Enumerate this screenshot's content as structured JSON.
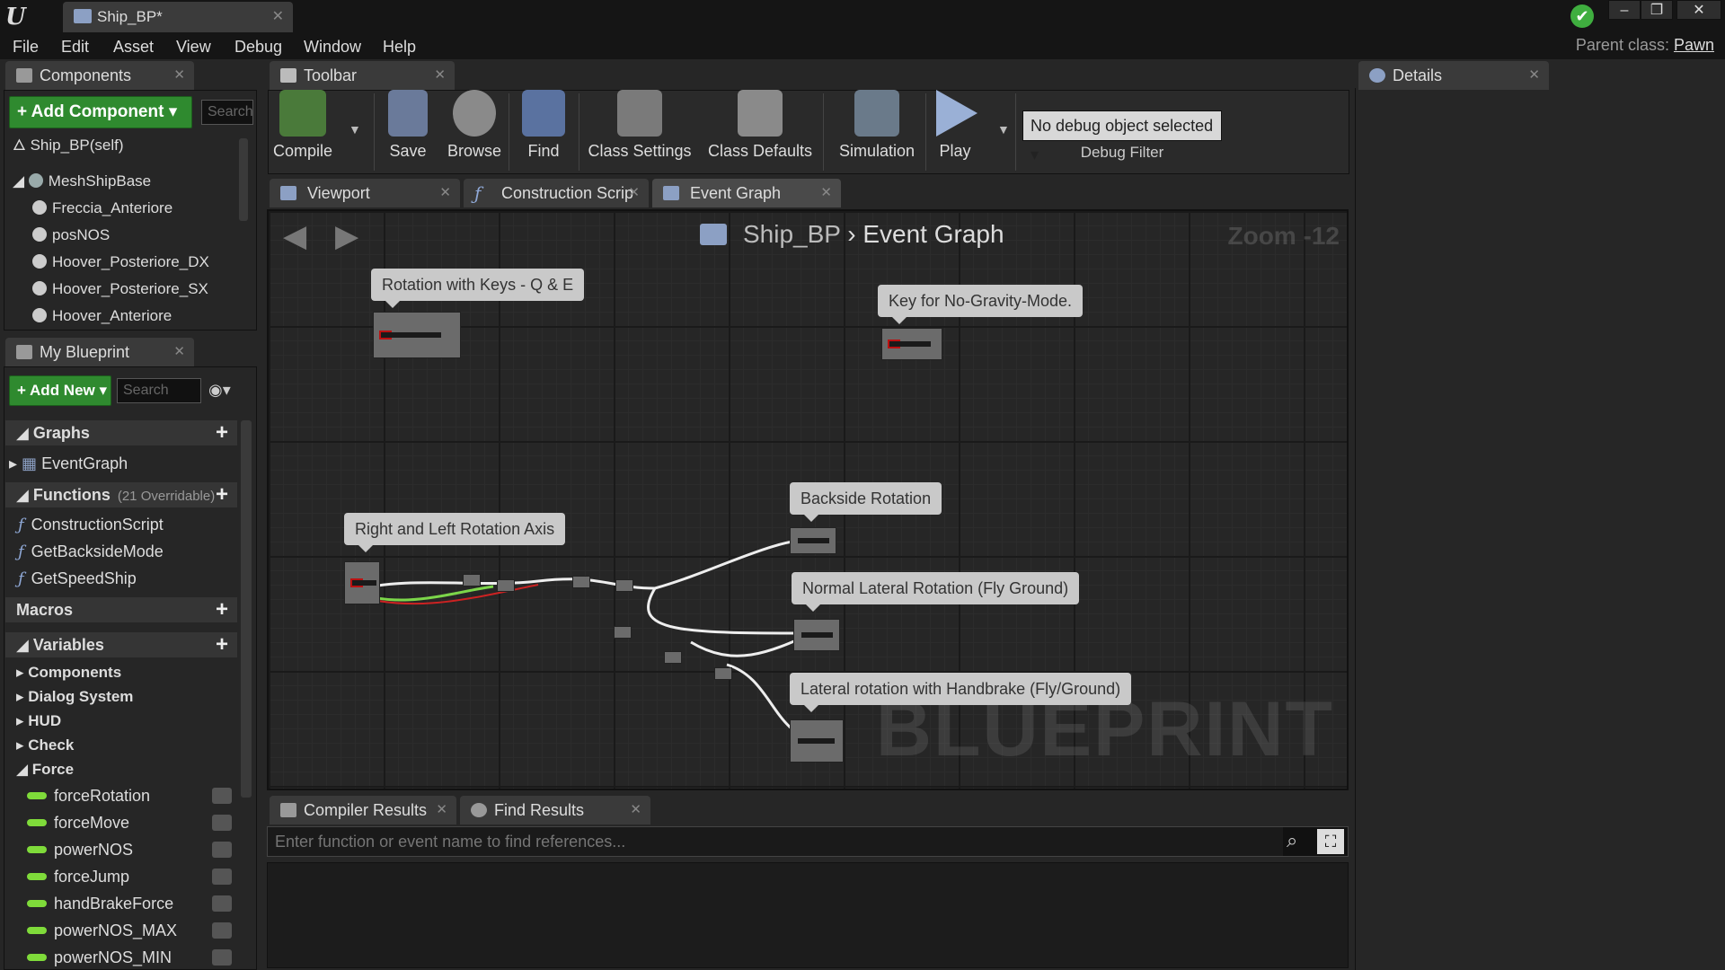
{
  "window": {
    "tab_title": "Ship_BP*",
    "parent_label": "Parent class:",
    "parent_value": "Pawn"
  },
  "menu": [
    "File",
    "Edit",
    "Asset",
    "View",
    "Debug",
    "Window",
    "Help"
  ],
  "components": {
    "tab": "Components",
    "add_label": "Add Component",
    "search_placeholder": "Search",
    "self": "Ship_BP(self)",
    "tree": [
      "MeshShipBase",
      "Freccia_Anteriore",
      "posNOS",
      "Hoover_Posteriore_DX",
      "Hoover_Posteriore_SX",
      "Hoover_Anteriore"
    ]
  },
  "my_blueprint": {
    "tab": "My Blueprint",
    "add_label": "Add New",
    "search_placeholder": "Search",
    "graphs_label": "Graphs",
    "graphs": [
      "EventGraph"
    ],
    "functions_label": "Functions",
    "functions_count": "(21 Overridable)",
    "functions": [
      "ConstructionScript",
      "GetBacksideMode",
      "GetSpeedShip"
    ],
    "macros_label": "Macros",
    "variables_label": "Variables",
    "categories": [
      "Components",
      "Dialog System",
      "HUD",
      "Check",
      "Force"
    ],
    "variables": [
      "forceRotation",
      "forceMove",
      "powerNOS",
      "forceJump",
      "handBrakeForce",
      "powerNOS_MAX",
      "powerNOS_MIN"
    ]
  },
  "toolbar": {
    "tab": "Toolbar",
    "buttons": [
      "Compile",
      "Save",
      "Browse",
      "Find",
      "Class Settings",
      "Class Defaults",
      "Simulation",
      "Play"
    ],
    "debug_select": "No debug object selected",
    "debug_label": "Debug Filter"
  },
  "graph_tabs": [
    "Viewport",
    "Construction Scrip",
    "Event Graph"
  ],
  "graph": {
    "crumb_root": "Ship_BP",
    "crumb_leaf": "Event Graph",
    "zoom": "Zoom -12",
    "watermark": "BLUEPRINT",
    "comments": [
      "Rotation with Keys - Q & E",
      "Key for No-Gravity-Mode.",
      "Backside Rotation",
      "Right and Left Rotation Axis",
      "Normal Lateral Rotation (Fly Ground)",
      "Lateral rotation with Handbrake (Fly/Ground)"
    ]
  },
  "bottom": {
    "tabs": [
      "Compiler Results",
      "Find Results"
    ],
    "find_placeholder": "Enter function or event name to find references..."
  },
  "details": {
    "tab": "Details"
  }
}
